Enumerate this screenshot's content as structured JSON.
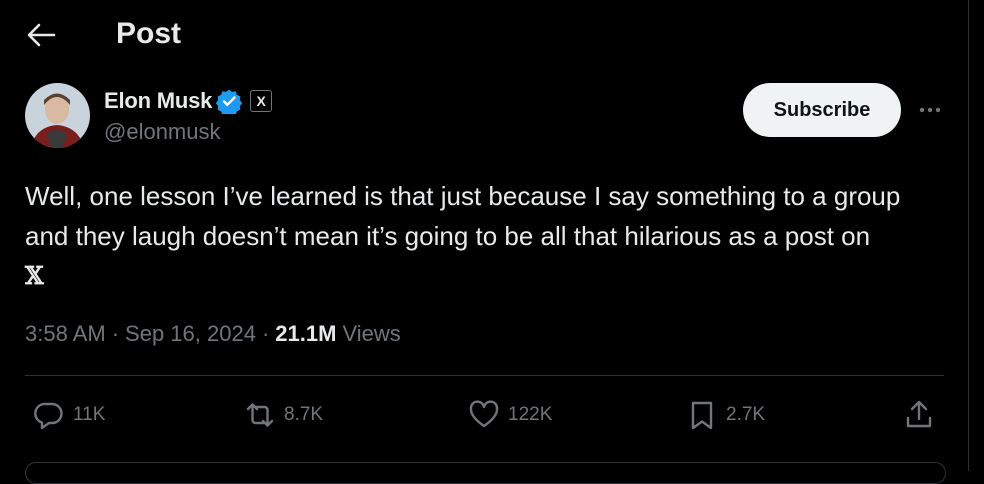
{
  "header": {
    "title": "Post",
    "back_icon": "back-arrow-icon"
  },
  "author": {
    "name": "Elon Musk",
    "handle": "@elonmusk",
    "verified_icon": "verified-badge-icon",
    "affiliation_badge": "X",
    "verified_color": "#1d9bf0"
  },
  "subscribe_label": "Subscribe",
  "post": {
    "line1": "Well, one lesson I’ve learned is that just because I say something to a group",
    "line2": "and they laugh doesn’t mean it’s going to be all that hilarious as a post on",
    "line3": "𝕏"
  },
  "meta": {
    "time": "3:58 AM",
    "sep1": "·",
    "date": "Sep 16, 2024",
    "sep2": "·",
    "views_count": "21.1M",
    "views_label": "Views"
  },
  "actions": {
    "replies": "11K",
    "reposts": "8.7K",
    "likes": "122K",
    "bookmarks": "2.7K"
  },
  "colors": {
    "background": "#000000",
    "text": "#e7e9ea",
    "secondary": "#71767b",
    "divider": "#2f3336"
  }
}
